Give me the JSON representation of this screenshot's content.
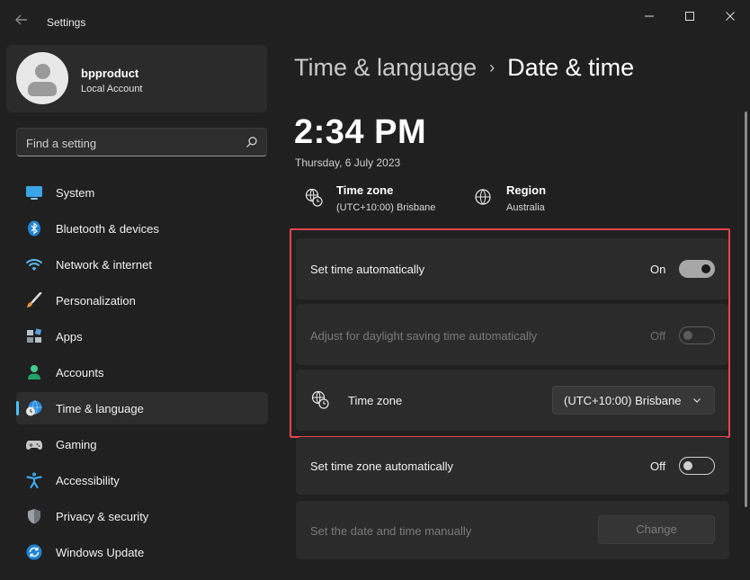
{
  "window": {
    "title": "Settings"
  },
  "profile": {
    "name": "bpproduct",
    "account_type": "Local Account"
  },
  "search": {
    "placeholder": "Find a setting"
  },
  "sidebar": {
    "items": [
      {
        "label": "System",
        "icon": "system-icon"
      },
      {
        "label": "Bluetooth & devices",
        "icon": "bluetooth-icon"
      },
      {
        "label": "Network & internet",
        "icon": "wifi-icon"
      },
      {
        "label": "Personalization",
        "icon": "brush-icon"
      },
      {
        "label": "Apps",
        "icon": "apps-icon"
      },
      {
        "label": "Accounts",
        "icon": "accounts-icon"
      },
      {
        "label": "Time & language",
        "icon": "globe-clock-icon",
        "active": true
      },
      {
        "label": "Gaming",
        "icon": "gamepad-icon"
      },
      {
        "label": "Accessibility",
        "icon": "accessibility-icon"
      },
      {
        "label": "Privacy & security",
        "icon": "shield-icon"
      },
      {
        "label": "Windows Update",
        "icon": "update-icon"
      }
    ]
  },
  "header": {
    "parent": "Time & language",
    "separator": "›",
    "current": "Date & time"
  },
  "clock": {
    "time": "2:34 PM",
    "date": "Thursday, 6 July 2023"
  },
  "summary": {
    "timezone_title": "Time zone",
    "timezone_value": "(UTC+10:00) Brisbane",
    "region_title": "Region",
    "region_value": "Australia"
  },
  "settings": {
    "set_time_auto": {
      "label": "Set time automatically",
      "state": "On"
    },
    "daylight_saving": {
      "label": "Adjust for daylight saving time automatically",
      "state": "Off"
    },
    "time_zone": {
      "label": "Time zone",
      "selected": "(UTC+10:00) Brisbane"
    },
    "set_tz_auto": {
      "label": "Set time zone automatically",
      "state": "Off"
    },
    "manual": {
      "label": "Set the date and time manually",
      "button": "Change"
    }
  },
  "colors": {
    "accent": "#4cc2ff",
    "highlight_border": "#e5444a",
    "background": "#202020",
    "card": "#2b2b2b"
  }
}
